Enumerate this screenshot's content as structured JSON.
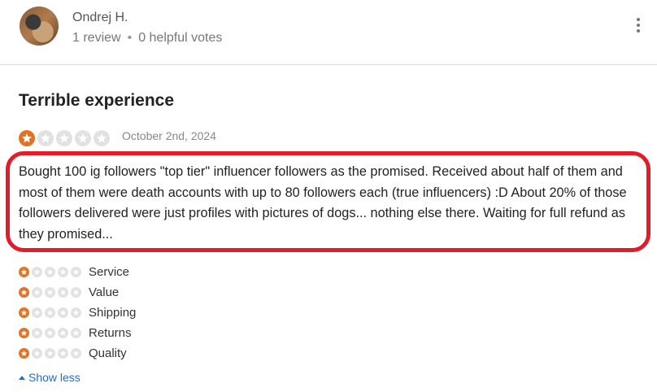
{
  "reviewer": {
    "name": "Ondrej H.",
    "reviews": "1 review",
    "separator": "•",
    "helpful_votes": "0 helpful votes"
  },
  "review": {
    "title": "Terrible experience",
    "rating": 1,
    "rating_max": 5,
    "date": "October 2nd, 2024",
    "body": "Bought 100 ig followers \"top tier\" influencer followers as the promised. Received about half of them and most of them were death accounts with up to 80 followers each (true influencers) :D About 20% of those followers delivered were just profiles with pictures of dogs... nothing else there. Waiting for full refund as they promised..."
  },
  "sub_ratings": [
    {
      "label": "Service",
      "rating": 1
    },
    {
      "label": "Value",
      "rating": 1
    },
    {
      "label": "Shipping",
      "rating": 1
    },
    {
      "label": "Returns",
      "rating": 1
    },
    {
      "label": "Quality",
      "rating": 1
    }
  ],
  "toggle": {
    "label": "Show less"
  },
  "colors": {
    "star_active": "#e37324",
    "highlight_border": "#e11d2a",
    "link": "#2a6ebb"
  }
}
